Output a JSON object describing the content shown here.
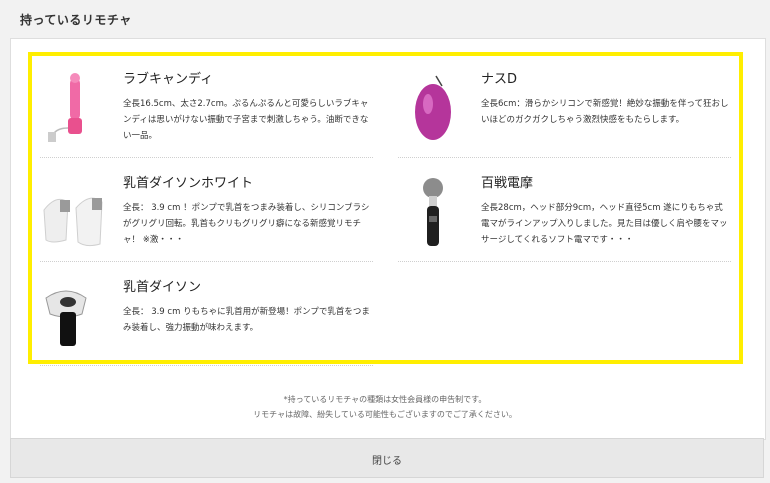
{
  "header": {
    "title": "持っているリモチャ"
  },
  "items": [
    {
      "name": "ラブキャンディ",
      "desc": "全長16.5cm、太さ2.7cm。ぷるんぷるんと可愛らしいラブキャンディは思いがけない振動で子宮まで刺激しちゃう。油断できない一品。",
      "icon": "pink-vibrator-icon"
    },
    {
      "name": "ナスD",
      "desc": "全長6cm：滑らかシリコンで新感覚！絶妙な振動を伴って狂おしいほどのガクガクしちゃう激烈快感をもたらします。",
      "icon": "purple-egg-vibrator-icon"
    },
    {
      "name": "乳首ダイソンホワイト",
      "desc": "全長： 3.9 cm ！ポンプで乳首をつまみ装着し、シリコンブラシがグリグリ回転。乳首もクリもグリグリ癖になる新感覚リモチャ！ ※激・・・",
      "icon": "white-nipple-pump-icon"
    },
    {
      "name": "百戦電摩",
      "desc": "全長28cm，ヘッド部分9cm，ヘッド直径5cm 遂にりもちゃ式電マがラインアップ入りしました。見た目は優しく肩や腰をマッサージしてくれるソフト電マです・・・",
      "icon": "massager-wand-icon"
    },
    {
      "name": "乳首ダイソン",
      "desc": "全長： 3.9 cm りもちゃに乳首用が新登場！ポンプで乳首をつまみ装着し、強力振動が味わえます。",
      "icon": "black-nipple-pump-icon"
    }
  ],
  "footnote": {
    "line1": "*持っているリモチャの種類は女性会員様の申告制です。",
    "line2": "リモチャは故障、紛失している可能性もございますのでご了承ください。"
  },
  "close_button": {
    "label": "閉じる"
  }
}
